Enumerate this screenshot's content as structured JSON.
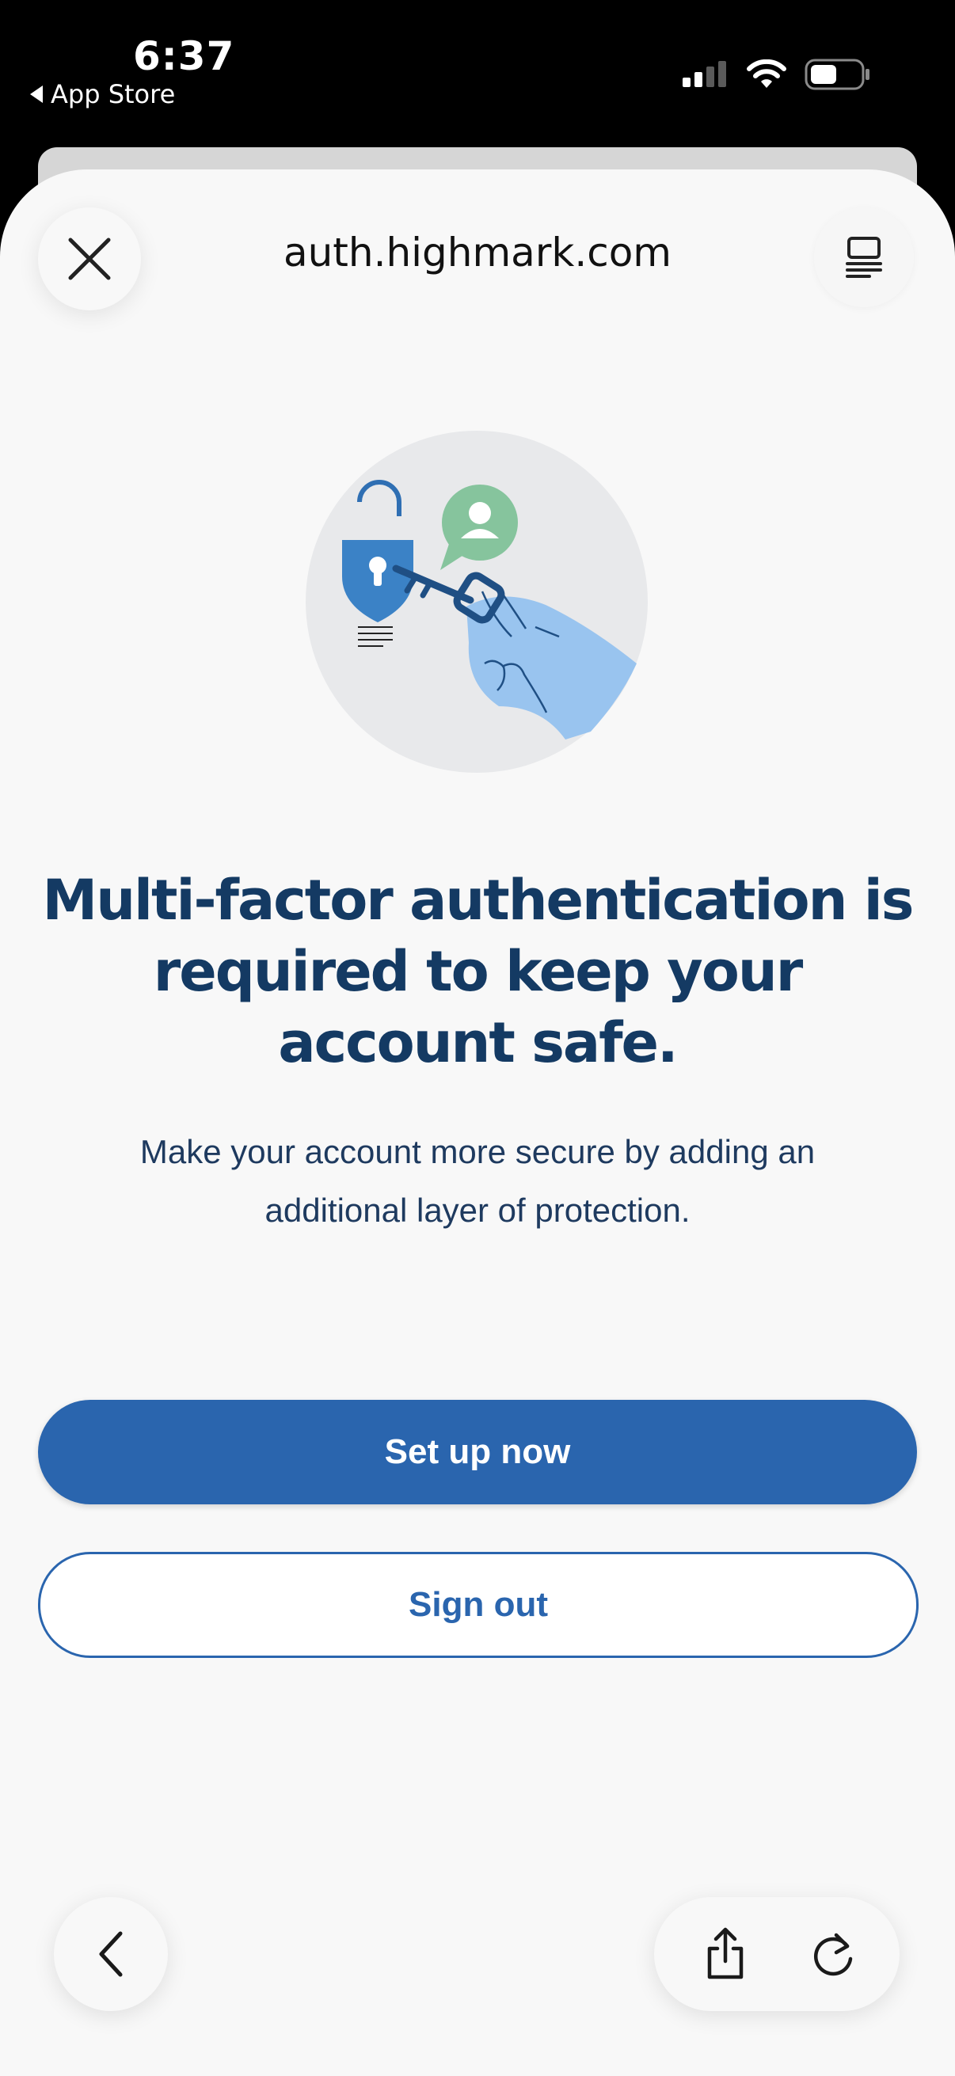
{
  "status_bar": {
    "time": "6:37",
    "back_app": "App Store"
  },
  "browser": {
    "url": "auth.highmark.com",
    "icons": {
      "close": "close-icon",
      "reader": "reader-mode-icon",
      "back": "chevron-left-icon",
      "share": "share-icon",
      "reload": "reload-icon"
    }
  },
  "page": {
    "headline": "Multi-factor authentication is required to keep your account safe.",
    "subtext": "Make your account more secure by adding an additional layer of protection.",
    "primary_button": "Set up now",
    "secondary_button": "Sign out",
    "illustration": "lock-and-key-illustration"
  },
  "colors": {
    "primary": "#2a65ae",
    "headline": "#143a63",
    "background": "#f8f8f8"
  }
}
